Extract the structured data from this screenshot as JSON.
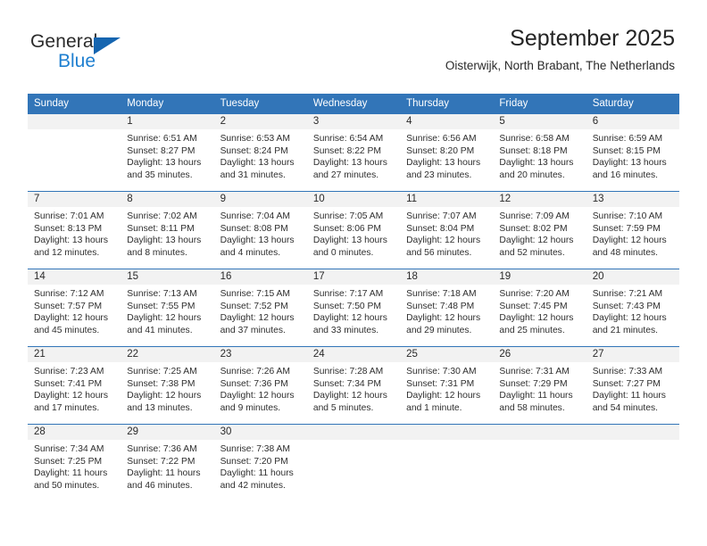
{
  "logo": {
    "primary_text": "General",
    "secondary_text": "Blue",
    "triangle_color": "#1565b0",
    "secondary_color": "#1e7fd0"
  },
  "header": {
    "title": "September 2025",
    "subtitle": "Oisterwijk, North Brabant, The Netherlands"
  },
  "theme": {
    "header_bg": "#3275b8",
    "header_text": "#ffffff",
    "daynum_band_bg": "#f2f2f2",
    "grid_line": "#3275b8"
  },
  "weekday_headers": [
    "Sunday",
    "Monday",
    "Tuesday",
    "Wednesday",
    "Thursday",
    "Friday",
    "Saturday"
  ],
  "weeks": [
    [
      {
        "day": "",
        "sunrise": "",
        "sunset": "",
        "daylight_line1": "",
        "daylight_line2": "",
        "empty": true
      },
      {
        "day": "1",
        "sunrise": "Sunrise: 6:51 AM",
        "sunset": "Sunset: 8:27 PM",
        "daylight_line1": "Daylight: 13 hours",
        "daylight_line2": "and 35 minutes."
      },
      {
        "day": "2",
        "sunrise": "Sunrise: 6:53 AM",
        "sunset": "Sunset: 8:24 PM",
        "daylight_line1": "Daylight: 13 hours",
        "daylight_line2": "and 31 minutes."
      },
      {
        "day": "3",
        "sunrise": "Sunrise: 6:54 AM",
        "sunset": "Sunset: 8:22 PM",
        "daylight_line1": "Daylight: 13 hours",
        "daylight_line2": "and 27 minutes."
      },
      {
        "day": "4",
        "sunrise": "Sunrise: 6:56 AM",
        "sunset": "Sunset: 8:20 PM",
        "daylight_line1": "Daylight: 13 hours",
        "daylight_line2": "and 23 minutes."
      },
      {
        "day": "5",
        "sunrise": "Sunrise: 6:58 AM",
        "sunset": "Sunset: 8:18 PM",
        "daylight_line1": "Daylight: 13 hours",
        "daylight_line2": "and 20 minutes."
      },
      {
        "day": "6",
        "sunrise": "Sunrise: 6:59 AM",
        "sunset": "Sunset: 8:15 PM",
        "daylight_line1": "Daylight: 13 hours",
        "daylight_line2": "and 16 minutes."
      }
    ],
    [
      {
        "day": "7",
        "sunrise": "Sunrise: 7:01 AM",
        "sunset": "Sunset: 8:13 PM",
        "daylight_line1": "Daylight: 13 hours",
        "daylight_line2": "and 12 minutes."
      },
      {
        "day": "8",
        "sunrise": "Sunrise: 7:02 AM",
        "sunset": "Sunset: 8:11 PM",
        "daylight_line1": "Daylight: 13 hours",
        "daylight_line2": "and 8 minutes."
      },
      {
        "day": "9",
        "sunrise": "Sunrise: 7:04 AM",
        "sunset": "Sunset: 8:08 PM",
        "daylight_line1": "Daylight: 13 hours",
        "daylight_line2": "and 4 minutes."
      },
      {
        "day": "10",
        "sunrise": "Sunrise: 7:05 AM",
        "sunset": "Sunset: 8:06 PM",
        "daylight_line1": "Daylight: 13 hours",
        "daylight_line2": "and 0 minutes."
      },
      {
        "day": "11",
        "sunrise": "Sunrise: 7:07 AM",
        "sunset": "Sunset: 8:04 PM",
        "daylight_line1": "Daylight: 12 hours",
        "daylight_line2": "and 56 minutes."
      },
      {
        "day": "12",
        "sunrise": "Sunrise: 7:09 AM",
        "sunset": "Sunset: 8:02 PM",
        "daylight_line1": "Daylight: 12 hours",
        "daylight_line2": "and 52 minutes."
      },
      {
        "day": "13",
        "sunrise": "Sunrise: 7:10 AM",
        "sunset": "Sunset: 7:59 PM",
        "daylight_line1": "Daylight: 12 hours",
        "daylight_line2": "and 48 minutes."
      }
    ],
    [
      {
        "day": "14",
        "sunrise": "Sunrise: 7:12 AM",
        "sunset": "Sunset: 7:57 PM",
        "daylight_line1": "Daylight: 12 hours",
        "daylight_line2": "and 45 minutes."
      },
      {
        "day": "15",
        "sunrise": "Sunrise: 7:13 AM",
        "sunset": "Sunset: 7:55 PM",
        "daylight_line1": "Daylight: 12 hours",
        "daylight_line2": "and 41 minutes."
      },
      {
        "day": "16",
        "sunrise": "Sunrise: 7:15 AM",
        "sunset": "Sunset: 7:52 PM",
        "daylight_line1": "Daylight: 12 hours",
        "daylight_line2": "and 37 minutes."
      },
      {
        "day": "17",
        "sunrise": "Sunrise: 7:17 AM",
        "sunset": "Sunset: 7:50 PM",
        "daylight_line1": "Daylight: 12 hours",
        "daylight_line2": "and 33 minutes."
      },
      {
        "day": "18",
        "sunrise": "Sunrise: 7:18 AM",
        "sunset": "Sunset: 7:48 PM",
        "daylight_line1": "Daylight: 12 hours",
        "daylight_line2": "and 29 minutes."
      },
      {
        "day": "19",
        "sunrise": "Sunrise: 7:20 AM",
        "sunset": "Sunset: 7:45 PM",
        "daylight_line1": "Daylight: 12 hours",
        "daylight_line2": "and 25 minutes."
      },
      {
        "day": "20",
        "sunrise": "Sunrise: 7:21 AM",
        "sunset": "Sunset: 7:43 PM",
        "daylight_line1": "Daylight: 12 hours",
        "daylight_line2": "and 21 minutes."
      }
    ],
    [
      {
        "day": "21",
        "sunrise": "Sunrise: 7:23 AM",
        "sunset": "Sunset: 7:41 PM",
        "daylight_line1": "Daylight: 12 hours",
        "daylight_line2": "and 17 minutes."
      },
      {
        "day": "22",
        "sunrise": "Sunrise: 7:25 AM",
        "sunset": "Sunset: 7:38 PM",
        "daylight_line1": "Daylight: 12 hours",
        "daylight_line2": "and 13 minutes."
      },
      {
        "day": "23",
        "sunrise": "Sunrise: 7:26 AM",
        "sunset": "Sunset: 7:36 PM",
        "daylight_line1": "Daylight: 12 hours",
        "daylight_line2": "and 9 minutes."
      },
      {
        "day": "24",
        "sunrise": "Sunrise: 7:28 AM",
        "sunset": "Sunset: 7:34 PM",
        "daylight_line1": "Daylight: 12 hours",
        "daylight_line2": "and 5 minutes."
      },
      {
        "day": "25",
        "sunrise": "Sunrise: 7:30 AM",
        "sunset": "Sunset: 7:31 PM",
        "daylight_line1": "Daylight: 12 hours",
        "daylight_line2": "and 1 minute."
      },
      {
        "day": "26",
        "sunrise": "Sunrise: 7:31 AM",
        "sunset": "Sunset: 7:29 PM",
        "daylight_line1": "Daylight: 11 hours",
        "daylight_line2": "and 58 minutes."
      },
      {
        "day": "27",
        "sunrise": "Sunrise: 7:33 AM",
        "sunset": "Sunset: 7:27 PM",
        "daylight_line1": "Daylight: 11 hours",
        "daylight_line2": "and 54 minutes."
      }
    ],
    [
      {
        "day": "28",
        "sunrise": "Sunrise: 7:34 AM",
        "sunset": "Sunset: 7:25 PM",
        "daylight_line1": "Daylight: 11 hours",
        "daylight_line2": "and 50 minutes."
      },
      {
        "day": "29",
        "sunrise": "Sunrise: 7:36 AM",
        "sunset": "Sunset: 7:22 PM",
        "daylight_line1": "Daylight: 11 hours",
        "daylight_line2": "and 46 minutes."
      },
      {
        "day": "30",
        "sunrise": "Sunrise: 7:38 AM",
        "sunset": "Sunset: 7:20 PM",
        "daylight_line1": "Daylight: 11 hours",
        "daylight_line2": "and 42 minutes."
      },
      {
        "day": "",
        "sunrise": "",
        "sunset": "",
        "daylight_line1": "",
        "daylight_line2": "",
        "empty": true
      },
      {
        "day": "",
        "sunrise": "",
        "sunset": "",
        "daylight_line1": "",
        "daylight_line2": "",
        "empty": true
      },
      {
        "day": "",
        "sunrise": "",
        "sunset": "",
        "daylight_line1": "",
        "daylight_line2": "",
        "empty": true
      },
      {
        "day": "",
        "sunrise": "",
        "sunset": "",
        "daylight_line1": "",
        "daylight_line2": "",
        "empty": true
      }
    ]
  ]
}
